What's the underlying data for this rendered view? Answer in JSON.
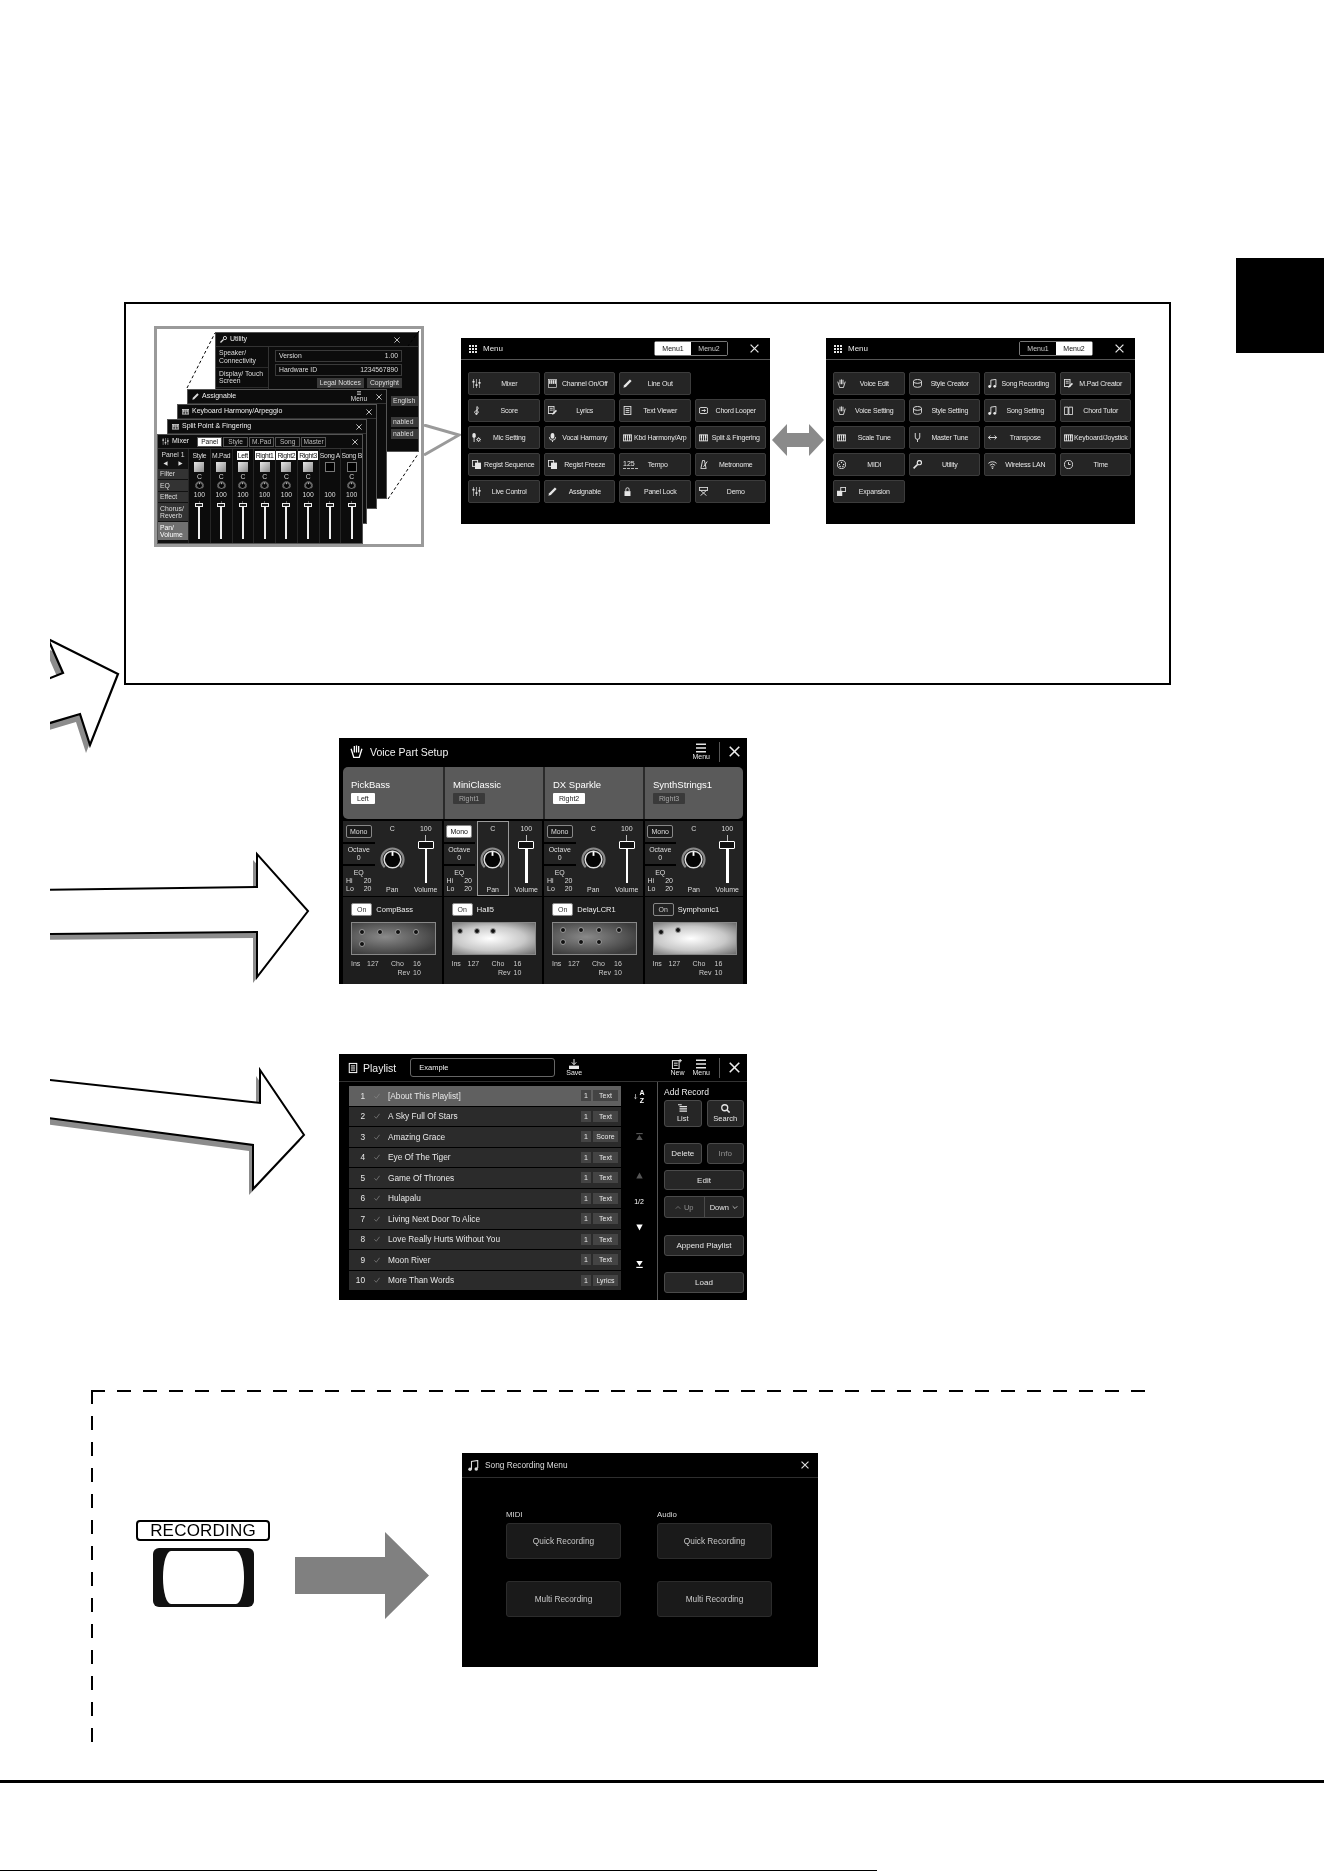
{
  "overview": {
    "thumbnail_stack": {
      "utility": {
        "title": "Utility",
        "sidebar": [
          "Speaker/ Connectivity",
          "Display/ Touch Screen"
        ],
        "rows": [
          {
            "label": "Version",
            "value": "1.00"
          },
          {
            "label": "Hardware ID",
            "value": "1234567890"
          }
        ],
        "buttons": [
          "Legal Notices",
          "Copyright"
        ],
        "side_values": [
          "English",
          "nabled",
          "nabled"
        ]
      },
      "assignable": {
        "title": "Assignable",
        "menu_label": "Menu"
      },
      "keyboard_harmony": {
        "title": "Keyboard Harmony/Arpeggio"
      },
      "split_point": {
        "title": "Split Point & Fingering"
      },
      "mixer": {
        "title": "Mixer",
        "tabs": [
          {
            "label": "Panel",
            "selected": true
          },
          {
            "label": "Style",
            "selected": false
          },
          {
            "label": "M.Pad",
            "selected": false
          },
          {
            "label": "Song",
            "selected": false
          },
          {
            "label": "Master",
            "selected": false
          }
        ],
        "page": "Panel 1",
        "sections": [
          {
            "label": "Filter",
            "selected": false
          },
          {
            "label": "EQ",
            "selected": false
          },
          {
            "label": "Effect",
            "selected": false
          },
          {
            "label": "Chorus/ Reverb",
            "selected": false
          },
          {
            "label": "Pan/ Volume",
            "selected": true
          }
        ],
        "channels": [
          {
            "name": "Style",
            "kind": "voice",
            "pan": "C",
            "volume": "100",
            "level": 0.85
          },
          {
            "name": "M.Pad",
            "kind": "voice",
            "pan": "C",
            "volume": "100",
            "level": 0.85
          },
          {
            "name": "Left",
            "kind": "part",
            "pan": "C",
            "volume": "100",
            "level": 0.85
          },
          {
            "name": "Right1",
            "kind": "part",
            "pan": "C",
            "volume": "100",
            "level": 0.85
          },
          {
            "name": "Right2",
            "kind": "part",
            "pan": "C",
            "volume": "100",
            "level": 0.85
          },
          {
            "name": "Right3",
            "kind": "part",
            "pan": "C",
            "volume": "100",
            "level": 0.85
          },
          {
            "name": "Song A",
            "kind": "song",
            "volume": "100",
            "level": 0.85
          },
          {
            "name": "Song B",
            "kind": "song",
            "pan": "C",
            "volume": "100",
            "level": 0.85
          }
        ]
      }
    },
    "menus": [
      {
        "title": "Menu",
        "tabs": [
          {
            "label": "Menu1",
            "selected": true
          },
          {
            "label": "Menu2",
            "selected": false
          }
        ],
        "rows": [
          [
            {
              "label": "Mixer"
            },
            {
              "label": "Channel On/Off"
            },
            {
              "label": "Line Out"
            }
          ],
          [
            {
              "label": "Score"
            },
            {
              "label": "Lyrics"
            },
            {
              "label": "Text Viewer"
            },
            {
              "label": "Chord Looper"
            }
          ],
          [
            {
              "label": "Mic Setting"
            },
            {
              "label": "Vocal Harmony"
            },
            {
              "label": "Kbd Harmony/Arp"
            },
            {
              "label": "Split & Fingering"
            }
          ],
          [
            {
              "label": "Regist Sequence"
            },
            {
              "label": "Regist Freeze"
            },
            {
              "label": "Tempo",
              "value": "125"
            },
            {
              "label": "Metronome"
            }
          ],
          [
            {
              "label": "Live Control"
            },
            {
              "label": "Assignable"
            },
            {
              "label": "Panel Lock"
            },
            {
              "label": "Demo"
            }
          ]
        ]
      },
      {
        "title": "Menu",
        "tabs": [
          {
            "label": "Menu1",
            "selected": false
          },
          {
            "label": "Menu2",
            "selected": true
          }
        ],
        "rows": [
          [
            {
              "label": "Voice Edit"
            },
            {
              "label": "Style Creator"
            },
            {
              "label": "Song Recording"
            },
            {
              "label": "M.Pad Creator"
            }
          ],
          [
            {
              "label": "Voice Setting"
            },
            {
              "label": "Style Setting"
            },
            {
              "label": "Song Setting"
            },
            {
              "label": "Chord Tutor"
            }
          ],
          [
            {
              "label": "Scale Tune"
            },
            {
              "label": "Master Tune"
            },
            {
              "label": "Transpose"
            },
            {
              "label": "Keyboard/Joystick"
            }
          ],
          [
            {
              "label": "MIDI"
            },
            {
              "label": "Utility"
            },
            {
              "label": "Wireless LAN"
            },
            {
              "label": "Time"
            }
          ],
          [
            {
              "label": "Expansion"
            }
          ]
        ]
      }
    ]
  },
  "voice_part_setup": {
    "title": "Voice Part Setup",
    "menu_label": "Menu",
    "parts": [
      {
        "name": "PickBass",
        "part": "Left",
        "part_on": true,
        "mono": "Mono",
        "mono_on": false,
        "octave_label": "Octave",
        "octave": "0",
        "eq_label": "EQ",
        "eq": [
          {
            "label": "Hi",
            "value": "20"
          },
          {
            "label": "Lo",
            "value": "20"
          }
        ],
        "pan": "C",
        "pan_label": "Pan",
        "pan_selected": false,
        "volume": "100",
        "volume_label": "Volume",
        "level": 0.7,
        "effect_switch": "On",
        "effect_on": true,
        "effect": "CompBass",
        "sends": [
          {
            "label": "Ins",
            "value": "127"
          },
          {
            "label": "Cho",
            "value": "16"
          },
          {
            "label": "Rev",
            "value": "10"
          }
        ]
      },
      {
        "name": "MiniClassic",
        "part": "Right1",
        "part_on": false,
        "mono": "Mono",
        "mono_on": true,
        "octave_label": "Octave",
        "octave": "0",
        "eq_label": "EQ",
        "eq": [
          {
            "label": "Hi",
            "value": "20"
          },
          {
            "label": "Lo",
            "value": "20"
          }
        ],
        "pan": "C",
        "pan_label": "Pan",
        "pan_selected": true,
        "volume": "100",
        "volume_label": "Volume",
        "level": 0.7,
        "effect_switch": "On",
        "effect_on": true,
        "effect": "Hall5",
        "sends": [
          {
            "label": "Ins",
            "value": "127"
          },
          {
            "label": "Cho",
            "value": "16"
          },
          {
            "label": "Rev",
            "value": "10"
          }
        ]
      },
      {
        "name": "DX Sparkle",
        "part": "Right2",
        "part_on": true,
        "mono": "Mono",
        "mono_on": false,
        "octave_label": "Octave",
        "octave": "0",
        "eq_label": "EQ",
        "eq": [
          {
            "label": "Hi",
            "value": "20"
          },
          {
            "label": "Lo",
            "value": "20"
          }
        ],
        "pan": "C",
        "pan_label": "Pan",
        "pan_selected": false,
        "volume": "100",
        "volume_label": "Volume",
        "level": 0.7,
        "effect_switch": "On",
        "effect_on": true,
        "effect": "DelayLCR1",
        "sends": [
          {
            "label": "Ins",
            "value": "127"
          },
          {
            "label": "Cho",
            "value": "16"
          },
          {
            "label": "Rev",
            "value": "10"
          }
        ]
      },
      {
        "name": "SynthStrings1",
        "part": "Right3",
        "part_on": false,
        "mono": "Mono",
        "mono_on": false,
        "octave_label": "Octave",
        "octave": "0",
        "eq_label": "EQ",
        "eq": [
          {
            "label": "Hi",
            "value": "20"
          },
          {
            "label": "Lo",
            "value": "20"
          }
        ],
        "pan": "C",
        "pan_label": "Pan",
        "pan_selected": false,
        "volume": "100",
        "volume_label": "Volume",
        "level": 0.7,
        "effect_switch": "On",
        "effect_on": false,
        "effect": "Symphonic1",
        "sends": [
          {
            "label": "Ins",
            "value": "127"
          },
          {
            "label": "Cho",
            "value": "16"
          },
          {
            "label": "Rev",
            "value": "10"
          }
        ]
      }
    ]
  },
  "playlist": {
    "title": "Playlist",
    "name_field": "Example",
    "tools": [
      {
        "kind": "save",
        "label": "Save"
      },
      {
        "kind": "new",
        "label": "New"
      },
      {
        "kind": "menu",
        "label": "Menu"
      }
    ],
    "rows": [
      {
        "number": "1",
        "title": "[About This Playlist]",
        "count": "1",
        "type": "Text",
        "selected": true
      },
      {
        "number": "2",
        "title": "A Sky Full Of Stars",
        "count": "1",
        "type": "Text",
        "selected": false
      },
      {
        "number": "3",
        "title": "Amazing Grace",
        "count": "1",
        "type": "Score",
        "selected": false
      },
      {
        "number": "4",
        "title": "Eye Of The Tiger",
        "count": "1",
        "type": "Text",
        "selected": false
      },
      {
        "number": "5",
        "title": "Game Of Thrones",
        "count": "1",
        "type": "Text",
        "selected": false
      },
      {
        "number": "6",
        "title": "Hulapalu",
        "count": "1",
        "type": "Text",
        "selected": false
      },
      {
        "number": "7",
        "title": "Living Next Door To Alice",
        "count": "1",
        "type": "Text",
        "selected": false
      },
      {
        "number": "8",
        "title": "Love Really Hurts Without You",
        "count": "1",
        "type": "Text",
        "selected": false
      },
      {
        "number": "9",
        "title": "Moon River",
        "count": "1",
        "type": "Text",
        "selected": false
      },
      {
        "number": "10",
        "title": "More Than Words",
        "count": "1",
        "type": "Lyrics",
        "selected": false
      }
    ],
    "sort": {
      "top": "A",
      "bottom": "Z"
    },
    "scroll": [
      {
        "kind": "top",
        "disabled": true
      },
      {
        "kind": "up",
        "disabled": true
      },
      {
        "kind": "page",
        "label": "1/2"
      },
      {
        "kind": "down",
        "disabled": false
      },
      {
        "kind": "bottom",
        "disabled": false
      }
    ],
    "add_record": {
      "label": "Add Record",
      "buttons": [
        {
          "kind": "list",
          "label": "List"
        },
        {
          "kind": "search",
          "label": "Search"
        }
      ]
    },
    "record_actions": [
      {
        "label": "Delete",
        "disabled": false
      },
      {
        "label": "Info",
        "disabled": true
      }
    ],
    "edit": "Edit",
    "move": [
      {
        "kind": "up",
        "label": "Up",
        "disabled": true
      },
      {
        "kind": "down",
        "label": "Down",
        "disabled": false
      }
    ],
    "append": "Append Playlist",
    "load": "Load"
  },
  "recording": {
    "panel_label": "RECORDING",
    "screen": {
      "title": "Song Recording Menu",
      "groups": [
        {
          "label": "MIDI",
          "buttons": [
            "Quick Recording",
            "Multi Recording"
          ]
        },
        {
          "label": "Audio",
          "buttons": [
            "Quick Recording",
            "Multi Recording"
          ]
        }
      ]
    }
  }
}
